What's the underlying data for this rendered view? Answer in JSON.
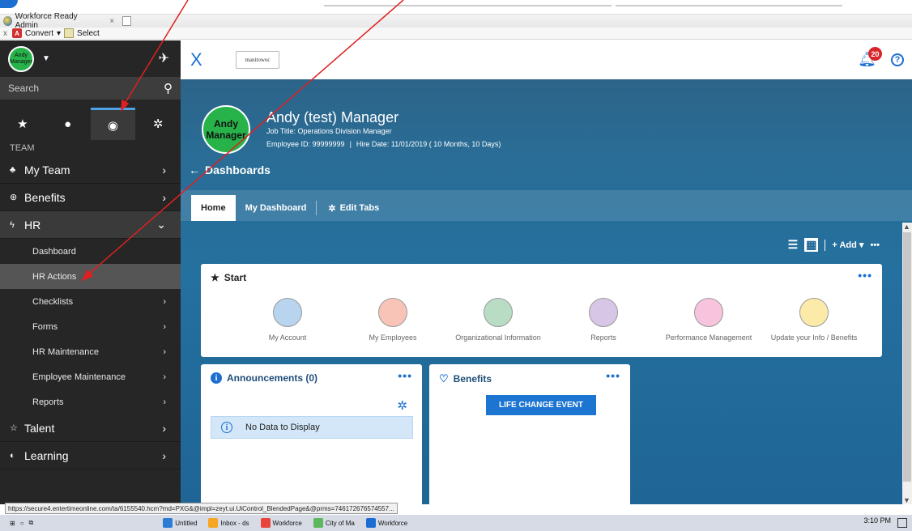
{
  "browser": {
    "tab_title": "Workforce Ready Admin",
    "tab_close": "×",
    "cmd_close": "x",
    "convert_label": "Convert",
    "select_label": "Select",
    "status_url": "https://secure4.entertimeonline.com/ta/6155540.hcm?md=PXG&@impl=zeyt.ui.UiControl_BlendedPage&@prms=746172676574557..."
  },
  "sidebar": {
    "avatar_text": "Andy Manager",
    "search_placeholder": "Search",
    "section_label": "TEAM",
    "items": [
      {
        "label": "My Team"
      },
      {
        "label": "Benefits"
      },
      {
        "label": "HR"
      },
      {
        "label": "Talent"
      },
      {
        "label": "Learning"
      }
    ],
    "hr_subitems": [
      {
        "label": "Dashboard"
      },
      {
        "label": "HR Actions"
      },
      {
        "label": "Checklists"
      },
      {
        "label": "Forms"
      },
      {
        "label": "HR Maintenance"
      },
      {
        "label": "Employee Maintenance"
      },
      {
        "label": "Reports"
      }
    ]
  },
  "header": {
    "close_glyph": "X",
    "company_logo_text": "manitowoc",
    "notification_count": "20",
    "help_glyph": "?"
  },
  "profile": {
    "avatar_text": "Andy Manager",
    "name": "Andy (test) Manager",
    "job_title": "Job Title: Operations Division Manager",
    "employee_id": "Employee ID: 99999999",
    "separator": "|",
    "hire_date": "Hire Date: 11/01/2019 ( 10 Months, 10 Days)"
  },
  "dashboards": {
    "title": "Dashboards",
    "tabs": [
      {
        "label": "Home"
      },
      {
        "label": "My Dashboard"
      },
      {
        "label": "Edit Tabs"
      }
    ],
    "add_label": "+ Add ▾",
    "more_glyph": "•••"
  },
  "start_card": {
    "title": "Start",
    "items": [
      {
        "label": "My Account",
        "color": "#b8d4ef"
      },
      {
        "label": "My Employees",
        "color": "#f9c4b8"
      },
      {
        "label": "Organizational Information",
        "color": "#b9dcc5"
      },
      {
        "label": "Reports",
        "color": "#d7c6e6"
      },
      {
        "label": "Performance Management",
        "color": "#f7c3dd"
      },
      {
        "label": "Update your Info / Benefits",
        "color": "#fbeaa8"
      }
    ]
  },
  "announcements": {
    "title": "Announcements (0)",
    "no_data": "No Data to Display"
  },
  "benefits": {
    "title": "Benefits",
    "button_label": "LIFE CHANGE EVENT"
  },
  "taskbar": {
    "apps": [
      {
        "label": "Untitled",
        "color": "#2b7cd3"
      },
      {
        "label": "Inbox - ds",
        "color": "#f5a623"
      },
      {
        "label": "Workforce",
        "color": "#e8453c"
      },
      {
        "label": "City of Ma",
        "color": "#5cb85c"
      },
      {
        "label": "Workforce",
        "color": "#1c6fd1"
      }
    ],
    "clock": "3:10 PM"
  },
  "colors": {
    "accent": "#1c6fd1",
    "sidebar_bg": "#262626",
    "avatar_green": "#27b34a",
    "annotation_red": "#e02020"
  }
}
